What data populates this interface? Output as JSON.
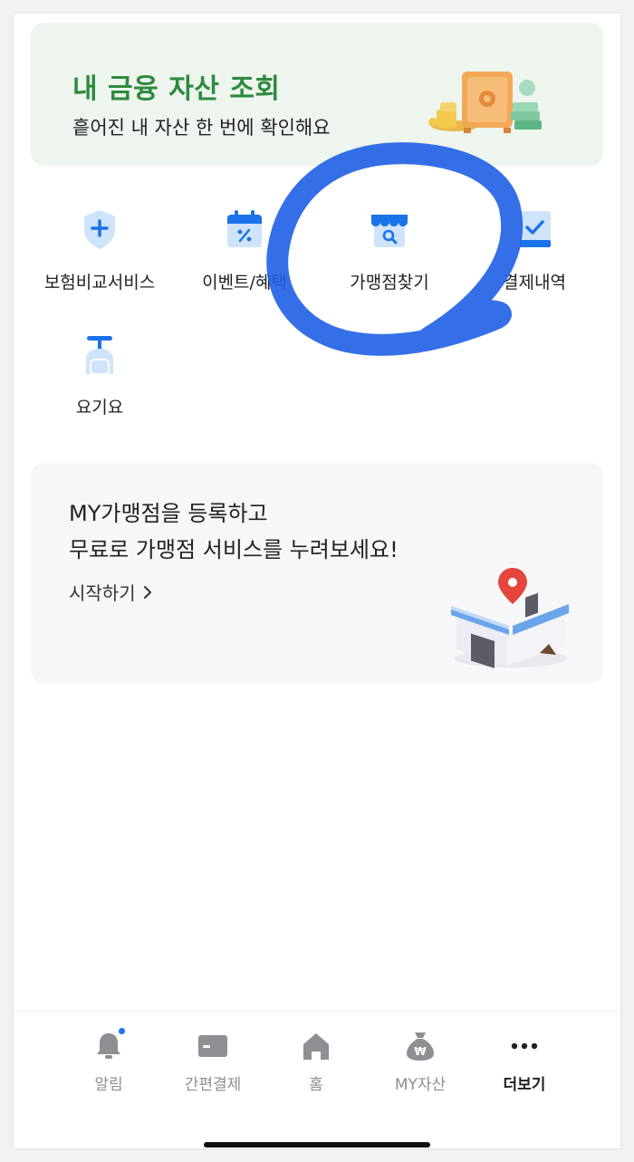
{
  "banner": {
    "title": "내 금융 자산 조회",
    "subtitle": "흩어진 내 자산 한 번에 확인해요",
    "accent": "#2e8a3f",
    "background": "#eef5ee"
  },
  "menu": [
    {
      "label": "보험비교서비스",
      "icon": "shield-plus-icon"
    },
    {
      "label": "이벤트/혜택",
      "icon": "calendar-percent-icon"
    },
    {
      "label": "가맹점찾기",
      "icon": "store-search-icon"
    },
    {
      "label": "결제내역",
      "icon": "receipt-check-icon"
    },
    {
      "label": "요기요",
      "icon": "scooter-icon"
    }
  ],
  "promo": {
    "line1": "MY가맹점을 등록하고",
    "line2": "무료로 가맹점 서비스를 누려보세요!",
    "cta": "시작하기",
    "cta_icon": "chevron-right-icon"
  },
  "tabbar": {
    "tabs": [
      {
        "label": "알림",
        "icon": "bell-icon",
        "has_badge": true
      },
      {
        "label": "간편결제",
        "icon": "card-icon"
      },
      {
        "label": "홈",
        "icon": "home-icon"
      },
      {
        "label": "MY자산",
        "icon": "money-bag-icon"
      },
      {
        "label": "더보기",
        "icon": "more-dots-icon",
        "active": true
      }
    ]
  },
  "colors": {
    "icon_blue": "#1a73e8",
    "icon_light_blue": "#cfe3fb",
    "annotation_blue": "#1f5fe6",
    "tab_inactive": "#8e8e93"
  }
}
